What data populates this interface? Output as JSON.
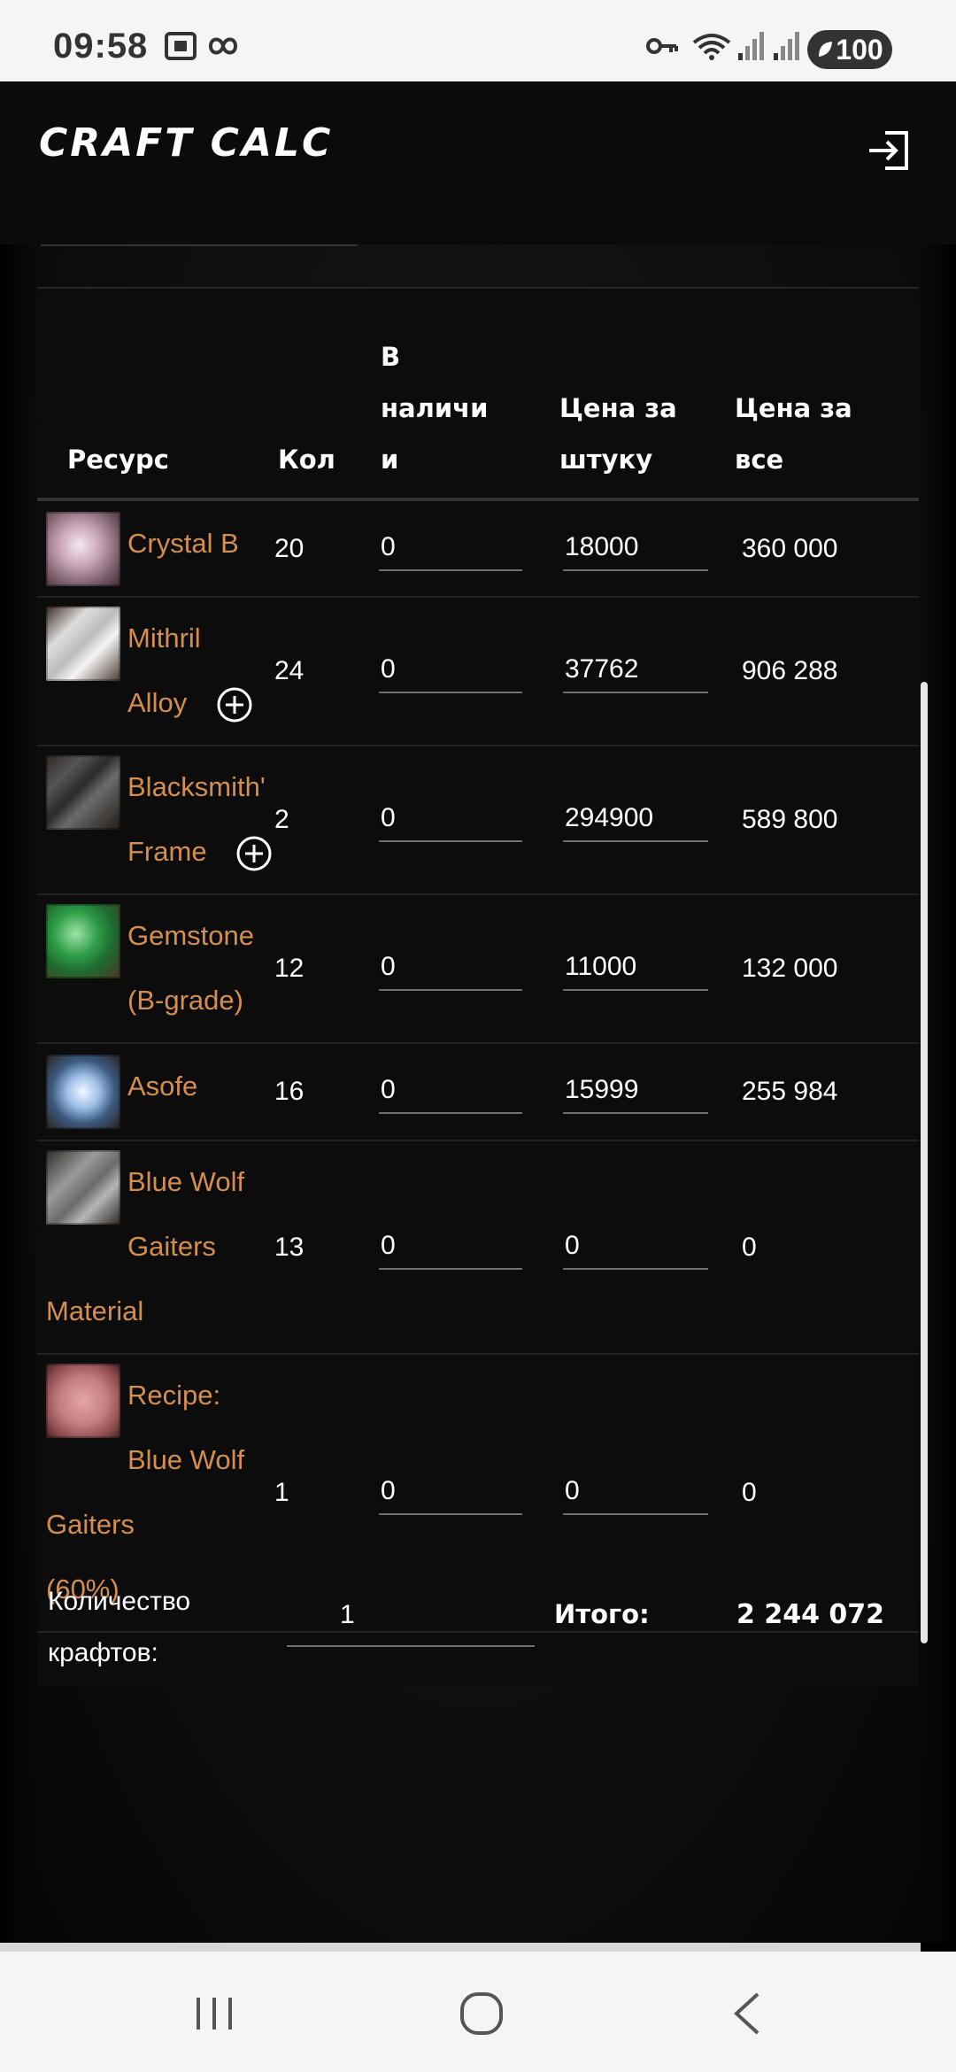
{
  "status_bar": {
    "time": "09:58",
    "battery": "100"
  },
  "app": {
    "title": "CRAFT CALC"
  },
  "table": {
    "headers": {
      "resource": "Ресурс",
      "qty": "Кол",
      "have_1": "В",
      "have_2": "наличи",
      "have_3": "и",
      "price_1": "Цена за",
      "price_2": "штуку",
      "total_1": "Цена за",
      "total_2": "все"
    },
    "rows": [
      {
        "name_1": "Crystal B",
        "name_2": "",
        "name_3": "",
        "icon": "crystal-icon",
        "qty": "20",
        "have": "0",
        "price": "18000",
        "total": "360 000"
      },
      {
        "name_1": "Mithril",
        "name_2": "Alloy",
        "name_3": "",
        "icon": "mithril-alloy-icon",
        "qty": "24",
        "have": "0",
        "price": "37762",
        "total": "906 288"
      },
      {
        "name_1": "Blacksmith'",
        "name_2": "Frame",
        "name_3": "",
        "icon": "blacksmith-frame-icon",
        "qty": "2",
        "have": "0",
        "price": "294900",
        "total": "589 800"
      },
      {
        "name_1": "Gemstone",
        "name_2": "(B-grade)",
        "name_3": "",
        "icon": "gemstone-icon",
        "qty": "12",
        "have": "0",
        "price": "11000",
        "total": "132 000"
      },
      {
        "name_1": "Asofe",
        "name_2": "",
        "name_3": "",
        "icon": "asofe-icon",
        "qty": "16",
        "have": "0",
        "price": "15999",
        "total": "255 984"
      },
      {
        "name_1": "Blue Wolf",
        "name_2": "Gaiters Material",
        "name_3": "",
        "icon": "gaiters-material-icon",
        "qty": "13",
        "have": "0",
        "price": "0",
        "total": "0"
      },
      {
        "name_1": "Recipe:",
        "name_2": "Blue Wolf Gaiters",
        "name_3": "(60%)",
        "icon": "recipe-icon",
        "qty": "1",
        "have": "0",
        "price": "0",
        "total": "0"
      }
    ]
  },
  "summary": {
    "crafts_label_1": "Количество",
    "crafts_label_2": "крафтов:",
    "crafts_value": "1",
    "total_label": "Итого:",
    "total_value": "2 244 072"
  }
}
